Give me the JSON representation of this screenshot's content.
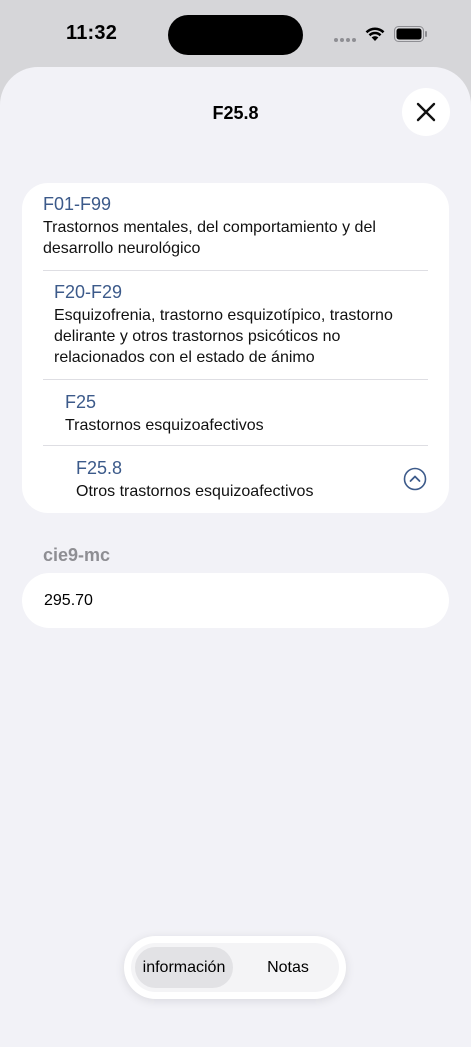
{
  "status_bar": {
    "time": "11:32"
  },
  "sheet": {
    "title": "F25.8",
    "close_icon": "close-icon"
  },
  "hierarchy": [
    {
      "code": "F01-F99",
      "description": "Trastornos mentales, del comportamiento y del desarrollo neurológico"
    },
    {
      "code": "F20-F29",
      "description": "Esquizofrenia, trastorno esquizotípico, trastorno delirante y otros trastornos psicóticos no relacionados con el estado de ánimo"
    },
    {
      "code": "F25",
      "description": "Trastornos esquizoafectivos"
    },
    {
      "code": "F25.8",
      "description": "Otros trastornos esquizoafectivos"
    }
  ],
  "cie9": {
    "label": "cie9-mc",
    "value": "295.70"
  },
  "tabs": [
    {
      "label": "información",
      "active": true
    },
    {
      "label": "Notas",
      "active": false
    }
  ],
  "colors": {
    "code_accent": "#3c5a8a",
    "background": "#f2f2f7",
    "section_label": "#8e8e93"
  }
}
